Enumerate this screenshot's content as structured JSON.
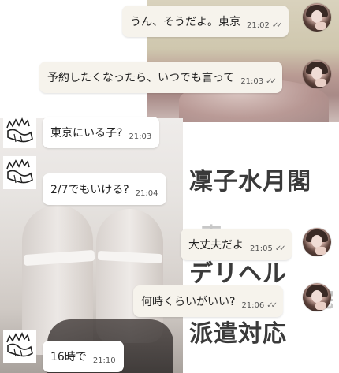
{
  "messages": [
    {
      "side": "out",
      "text": "うん、そうだよ。東京",
      "time": "21:02",
      "read": "✓✓"
    },
    {
      "side": "out",
      "text": "予約したくなったら、いつでも言って",
      "time": "21:03",
      "read": "✓✓"
    },
    {
      "side": "in",
      "text": "東京にいる子?",
      "time": "21:03"
    },
    {
      "side": "in",
      "text": "2/7でもいける?",
      "time": "21:04"
    },
    {
      "side": "out",
      "text": "大丈夫だよ",
      "time": "21:05",
      "read": "✓✓"
    },
    {
      "side": "out",
      "text": "何時くらいがいい?",
      "time": "21:06",
      "read": "✓✓"
    },
    {
      "side": "in",
      "text": "16時で",
      "time": "21:10"
    }
  ],
  "ad": {
    "line1": "凜子水月閣",
    "line2": "デリヘル",
    "line3": "派遣対応",
    "faint1": "東",
    "faint2": "宅"
  },
  "colors": {
    "outgoing_bubble": "#f6f3ec",
    "incoming_bubble": "#ffffff",
    "ad_text": "#3a3a3a"
  }
}
